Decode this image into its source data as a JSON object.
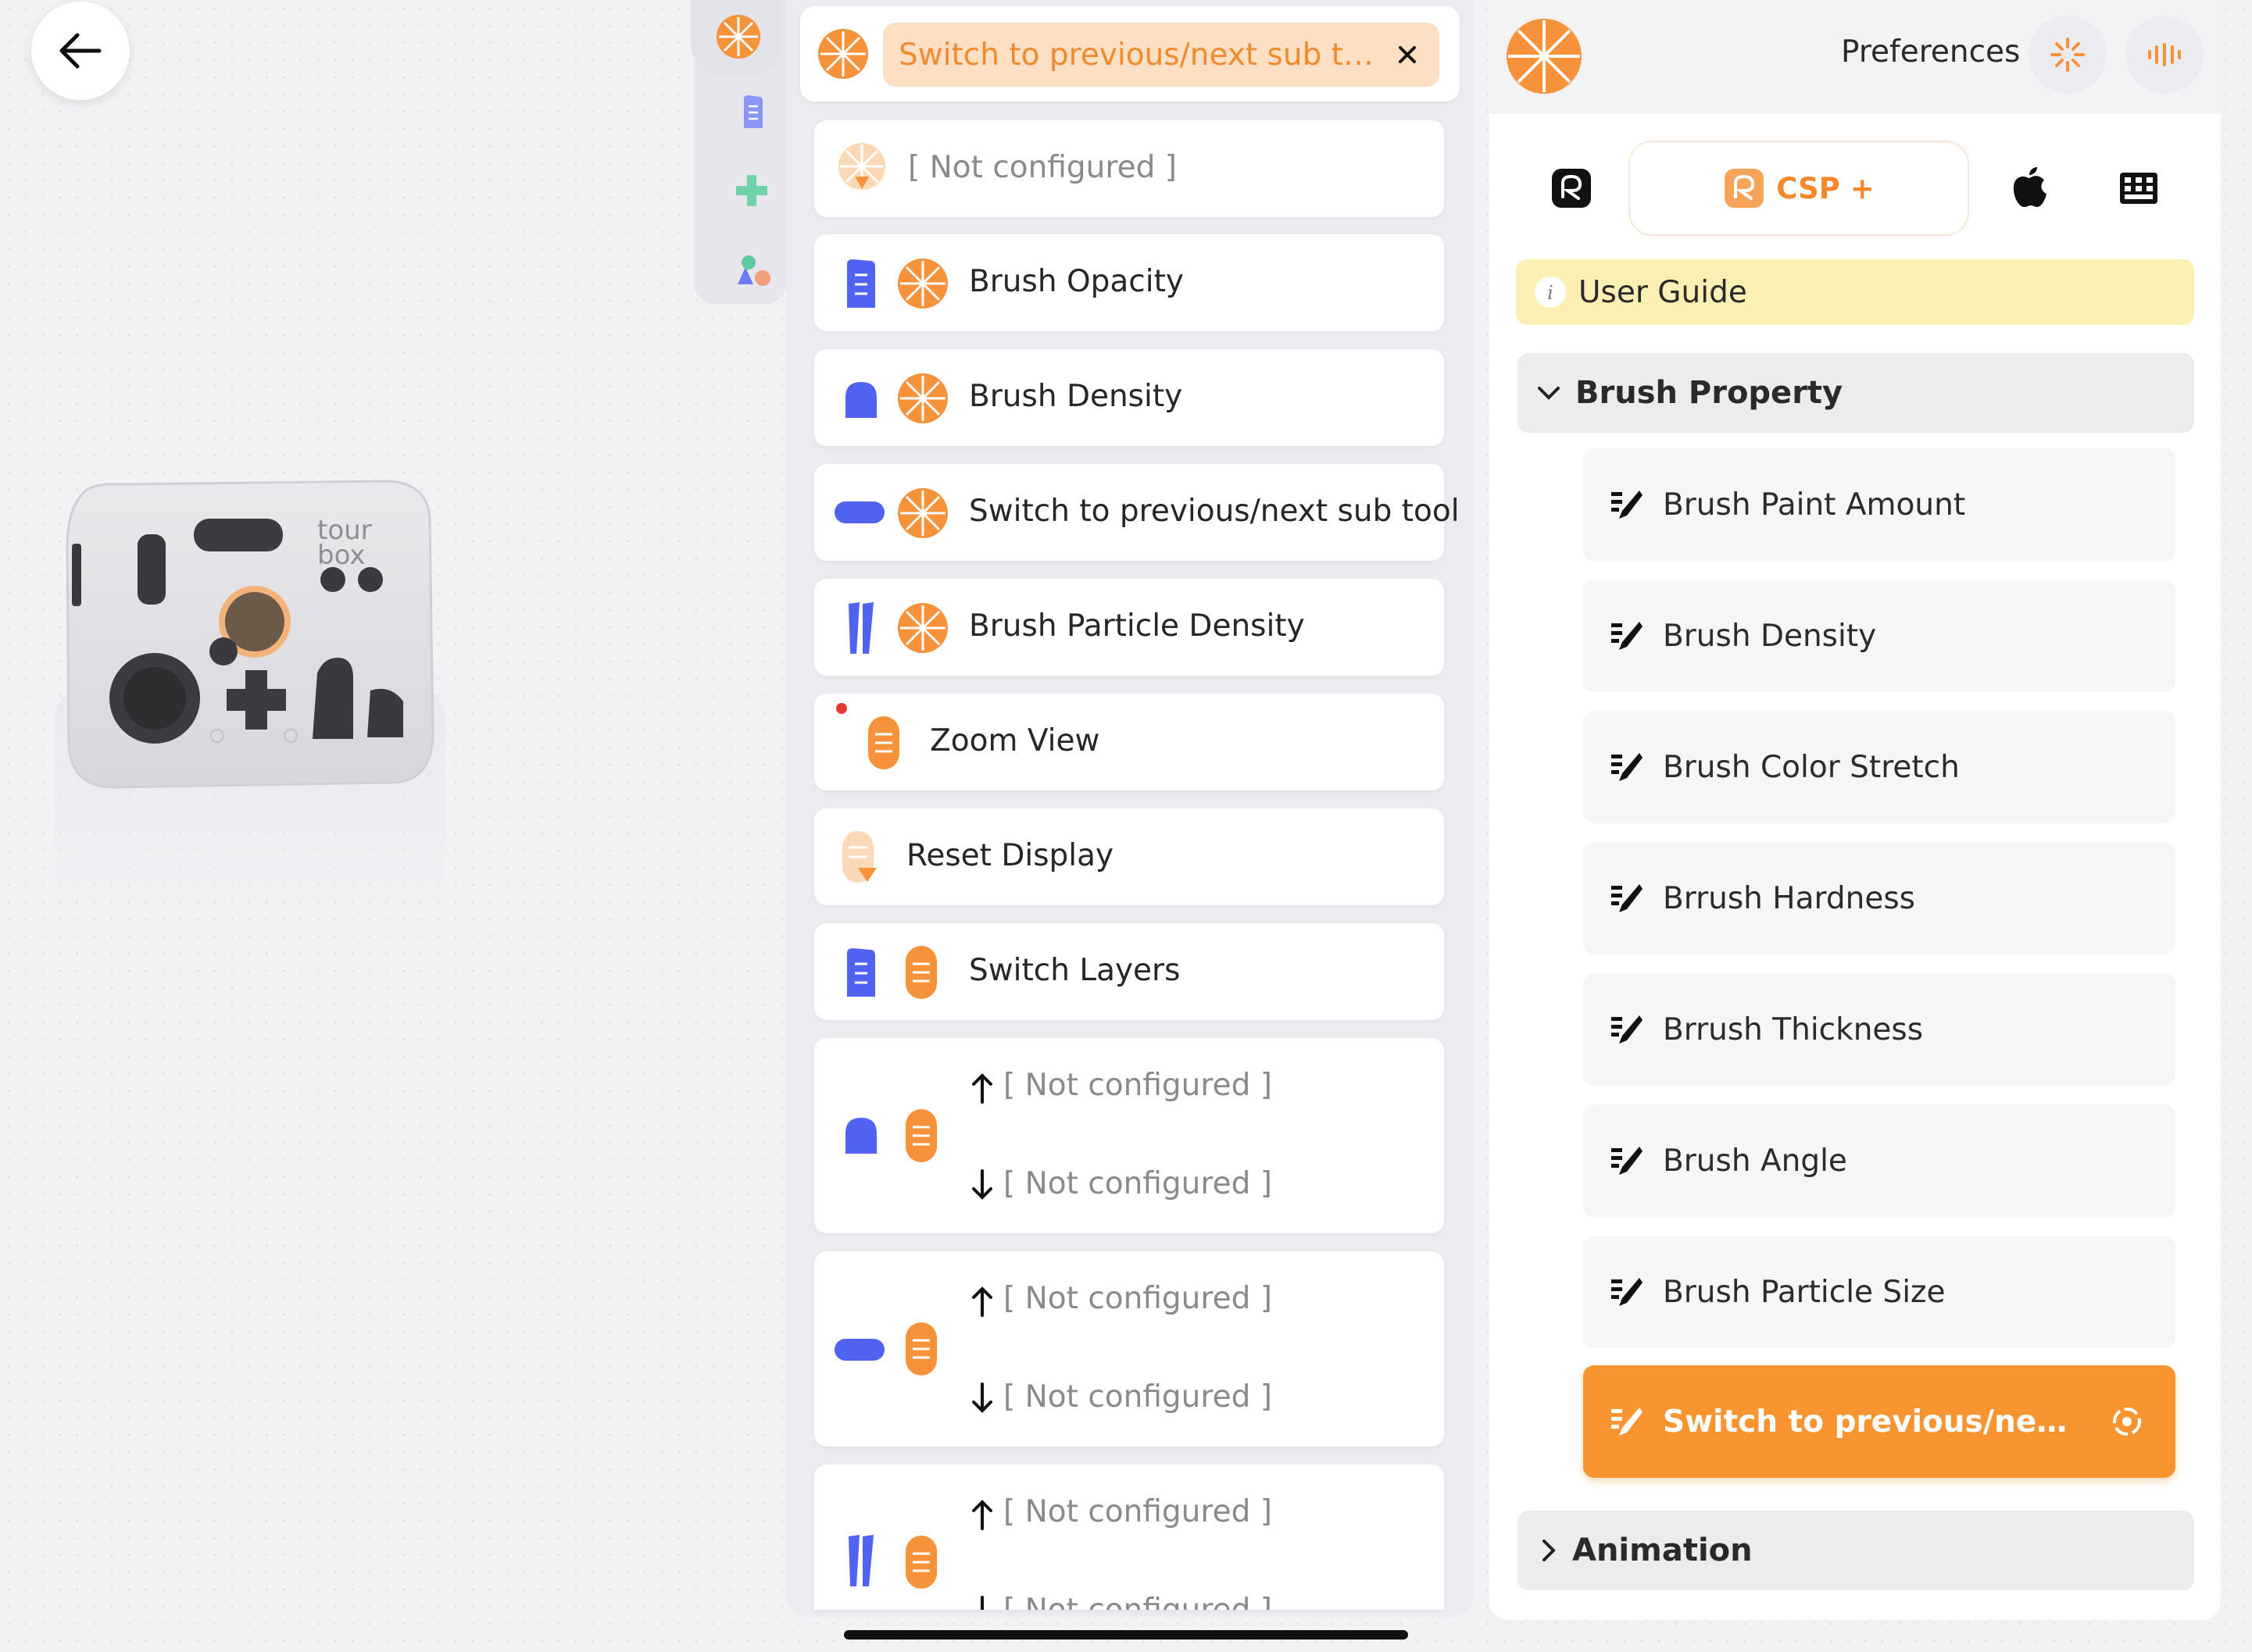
{
  "header": {
    "selected_action": "Switch to previous/next sub tool g...",
    "preferences_label": "Preferences"
  },
  "device": {
    "brand_text_top": "tour",
    "brand_text_bottom": "box"
  },
  "mappings": [
    {
      "label": "[ Not configured ]",
      "configured": false
    },
    {
      "label": "Brush Opacity",
      "configured": true
    },
    {
      "label": "Brush Density",
      "configured": true
    },
    {
      "label": "Switch to previous/next sub tool",
      "configured": true
    },
    {
      "label": "Brush Particle Density",
      "configured": true
    },
    {
      "label": "Zoom View",
      "configured": true
    },
    {
      "label": "Reset Display",
      "configured": true
    },
    {
      "label": "Switch Layers",
      "configured": true
    }
  ],
  "scroll_mappings": [
    {
      "up": "[ Not configured ]",
      "down": "[ Not configured ]"
    },
    {
      "up": "[ Not configured ]",
      "down": "[ Not configured ]"
    },
    {
      "up": "[ Not configured ]",
      "down": "[ Not configured ]"
    }
  ],
  "right_panel": {
    "app_tab_label": "CSP +",
    "user_guide": "User Guide",
    "groups": [
      {
        "title": "Brush Property",
        "expanded": true,
        "items": [
          "Brush Paint Amount",
          "Brush Density",
          "Brush Color Stretch",
          "Brrush Hardness",
          "Brrush Thickness",
          "Brush Angle",
          "Brush Particle Size",
          "Switch to previous/next s..."
        ],
        "active_item": "Switch to previous/next s..."
      },
      {
        "title": "Animation",
        "expanded": false
      }
    ]
  },
  "colors": {
    "accent_orange": "#f89530",
    "button_blue": "#4f62f0",
    "guide_yellow": "#fcefb4"
  }
}
